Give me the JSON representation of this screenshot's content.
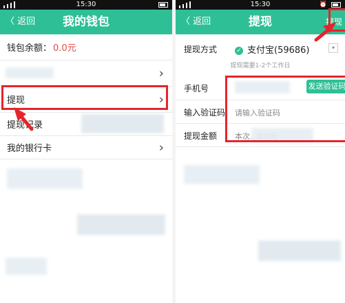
{
  "left": {
    "status_time": "15:30",
    "nav_back": "〈 返回",
    "nav_title": "我的钱包",
    "balance_label": "钱包余额：",
    "balance_value": "0.0元",
    "menu": [
      {
        "label": "提现"
      },
      {
        "label": "提现记录"
      },
      {
        "label": "我的银行卡"
      }
    ]
  },
  "right": {
    "status_time": "15:30",
    "nav_back": "〈 返回",
    "nav_title": "提现",
    "nav_right": "提现",
    "method_label": "提现方式",
    "method_value": "支付宝(59686)",
    "note": "提现需要1-2个工作日",
    "phone_label": "手机号",
    "send_code_button": "发送验证码",
    "code_label": "输入验证码",
    "code_placeholder": "请输入验证码",
    "amount_label": "提现金额",
    "amount_hint": "本次…0.0元"
  },
  "icons": {
    "chevron": "chevron-right-icon",
    "check": "check-circle-icon"
  },
  "colors": {
    "brand_green": "#2fbf96",
    "highlight_red": "#e5242b",
    "balance_red": "#e24b4b"
  }
}
